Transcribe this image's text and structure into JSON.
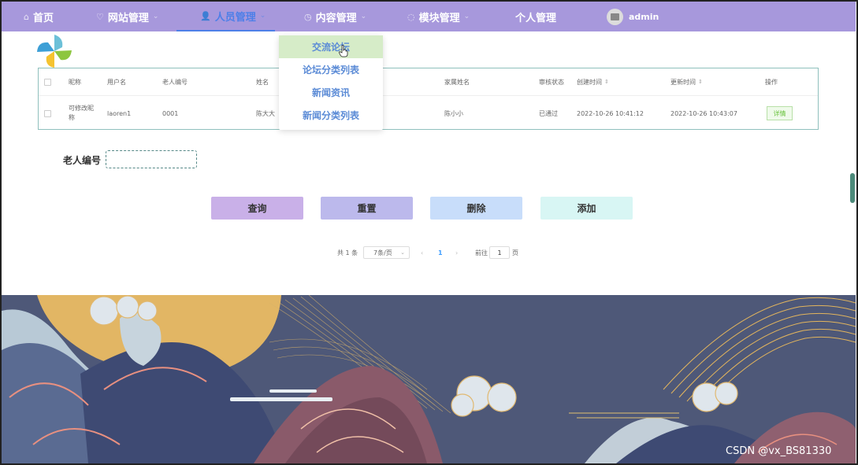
{
  "nav": {
    "items": [
      {
        "label": "首页",
        "icon": "home-icon"
      },
      {
        "label": "网站管理",
        "icon": "heart-icon"
      },
      {
        "label": "人员管理",
        "icon": "user-icon"
      },
      {
        "label": "内容管理",
        "icon": "clock-icon"
      },
      {
        "label": "模块管理",
        "icon": "circle-icon"
      },
      {
        "label": "个人管理",
        "icon": ""
      }
    ],
    "user": "admin",
    "accent": "#a798dc"
  },
  "dropdown": {
    "items": [
      "交流论坛",
      "论坛分类列表",
      "新闻资讯",
      "新闻分类列表"
    ]
  },
  "table": {
    "headers": [
      "昵称",
      "用户名",
      "老人编号",
      "姓名",
      "家属姓名",
      "审核状态",
      "创建时间",
      "更新时间",
      "操作"
    ],
    "rows": [
      {
        "nickname": "可修改昵称",
        "username": "laoren1",
        "elder_id": "0001",
        "name": "陈大大",
        "family_name": "陈小小",
        "status": "已通过",
        "created": "2022-10-26 10:41:12",
        "updated": "2022-10-26 10:43:07",
        "action": "详情"
      }
    ]
  },
  "search": {
    "label": "老人编号",
    "value": "",
    "placeholder": ""
  },
  "buttons": {
    "query": "查询",
    "reset": "重置",
    "delete": "删除",
    "add": "添加"
  },
  "pagination": {
    "total": "共 1 条",
    "page_size": "7条/页",
    "current_page": "1",
    "goto_label": "前往",
    "goto_value": "1",
    "page_suffix": "页"
  },
  "watermark": "CSDN @vx_BS81330"
}
